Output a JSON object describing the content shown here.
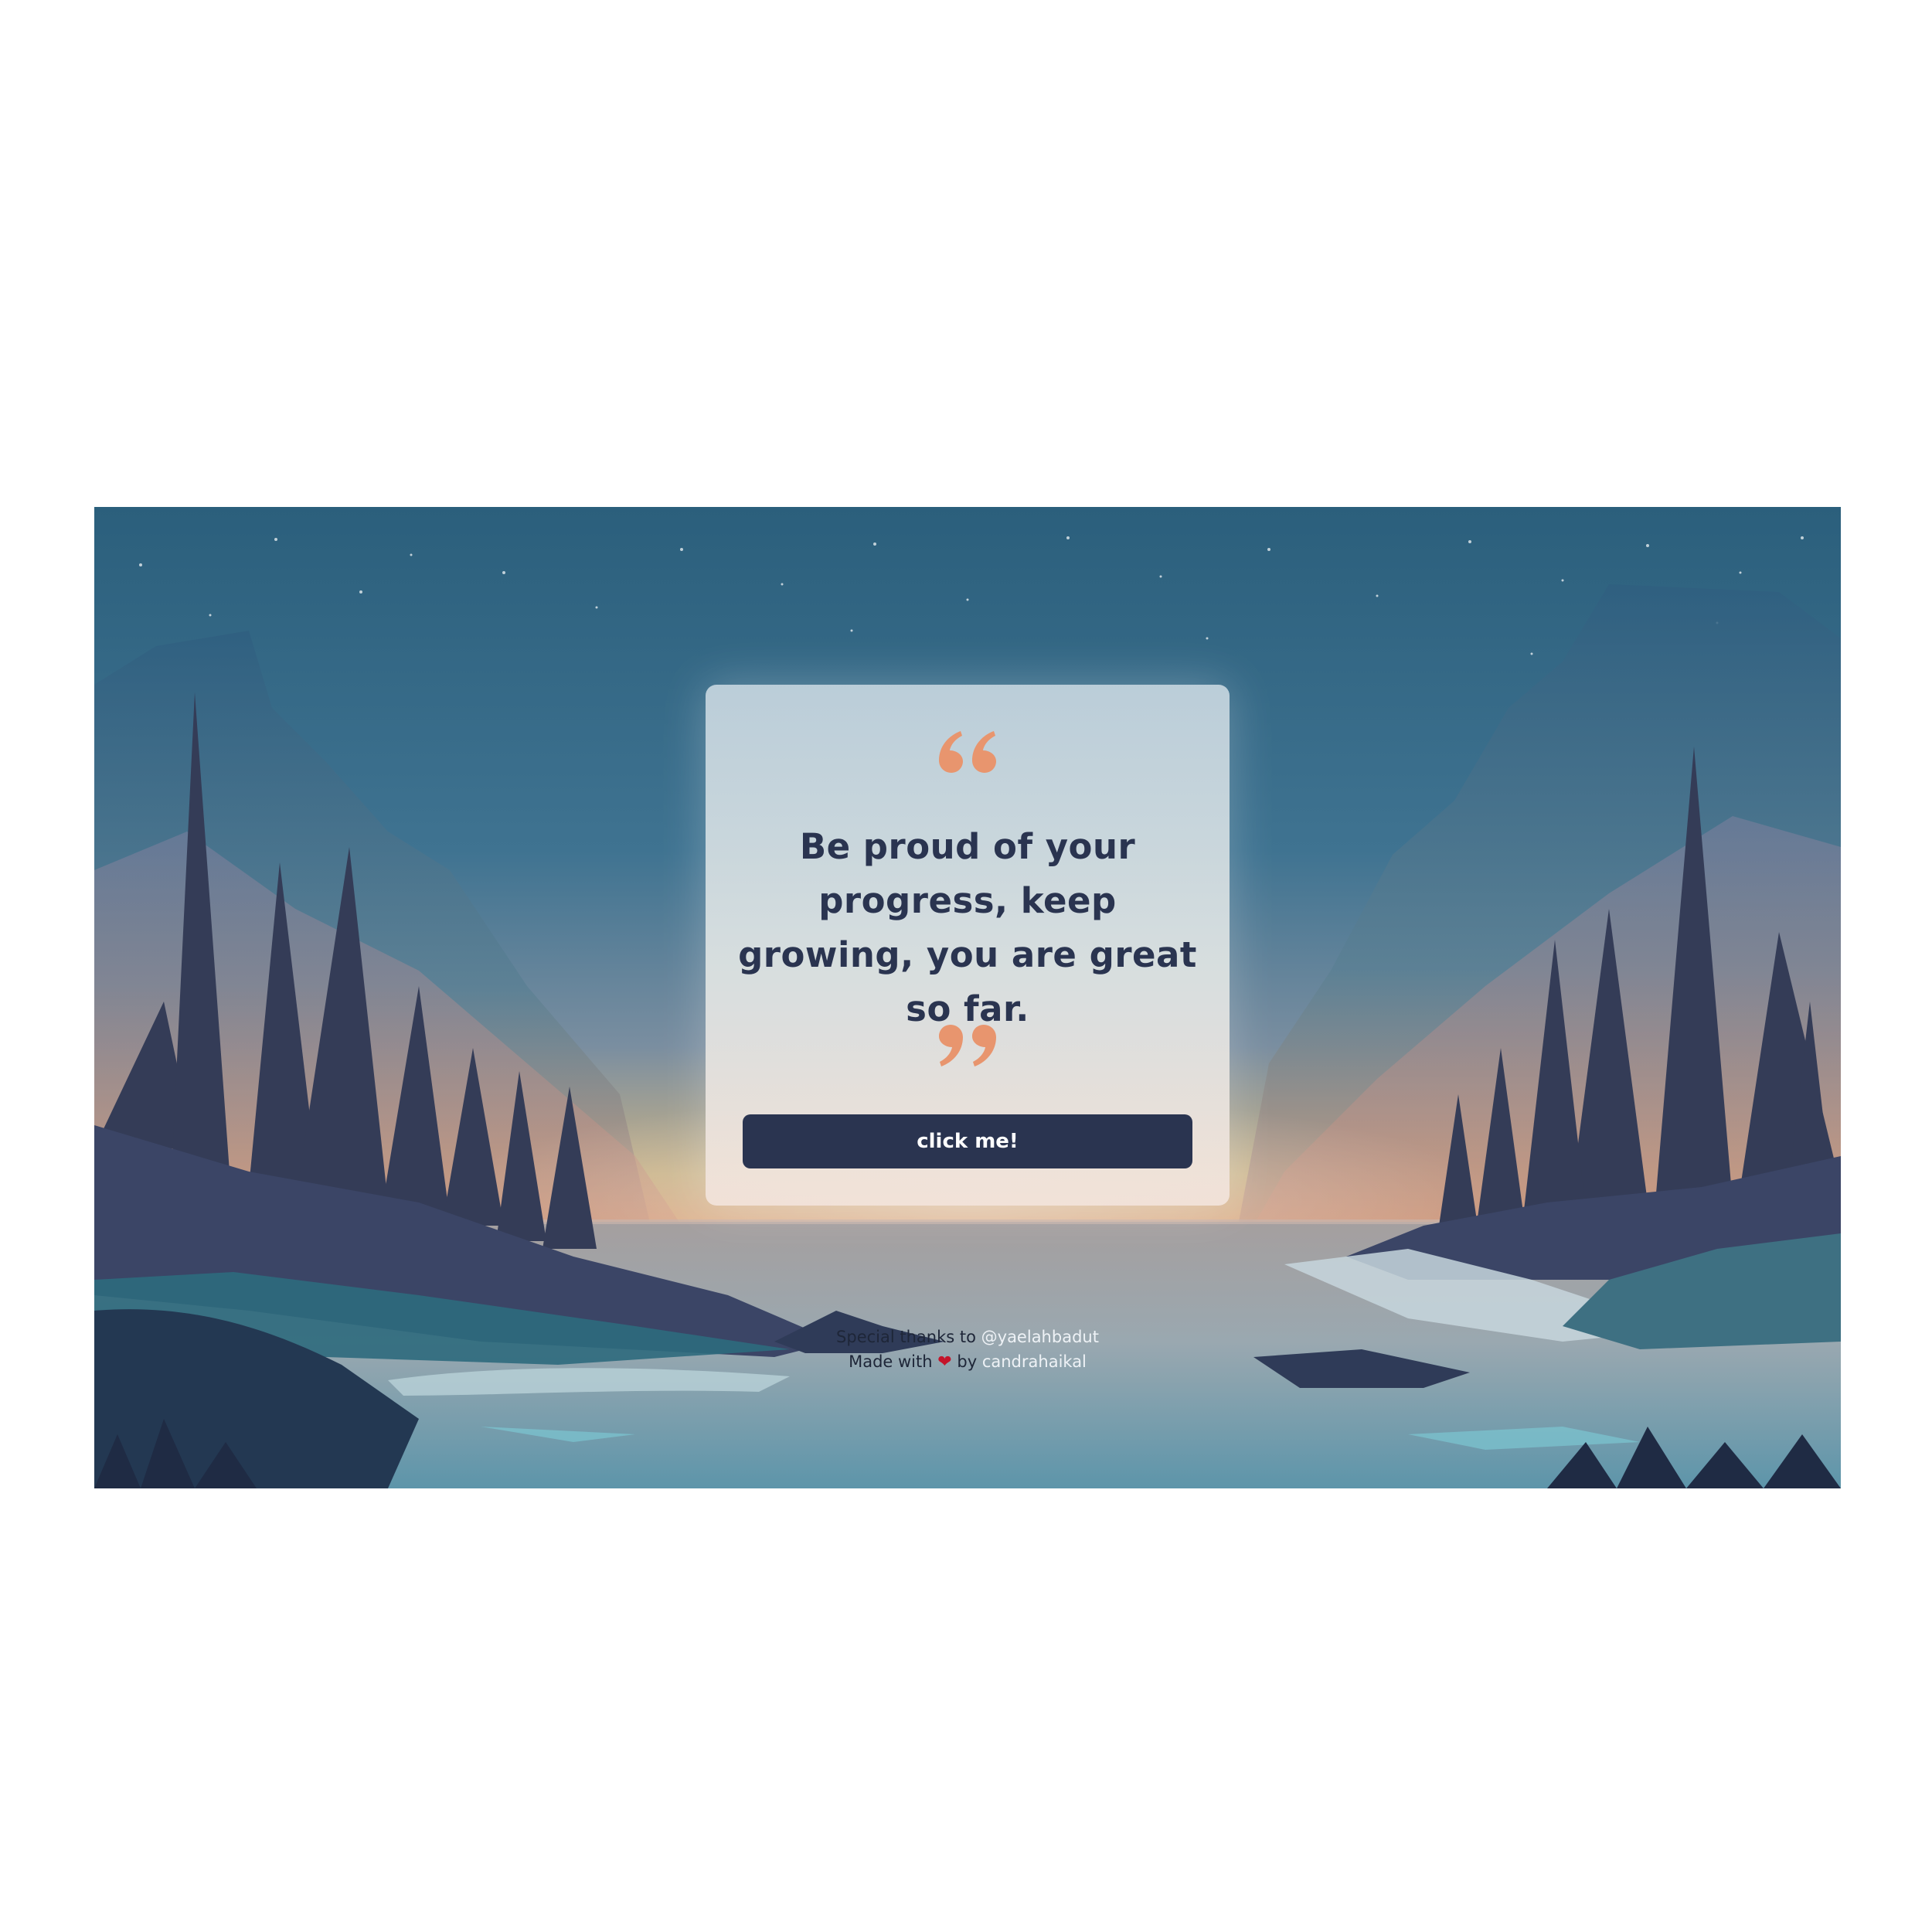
{
  "card": {
    "quote": "Be proud of your progress, keep growing, you are great so far.",
    "button_label": "click me!"
  },
  "credits": {
    "thanks_prefix": "Special thanks to",
    "thanks_handle": "@yaelahbadut",
    "made_prefix": "Made with",
    "made_by": "by",
    "author": "candrahaikal"
  },
  "colors": {
    "accent_quote": "#e8956e",
    "button_bg": "#2a3450",
    "text_dark": "#2a3450",
    "heart": "#c4142a"
  },
  "icons": {
    "open_quote": "open-quote-icon",
    "close_quote": "close-quote-icon",
    "heart": "heart-icon"
  }
}
